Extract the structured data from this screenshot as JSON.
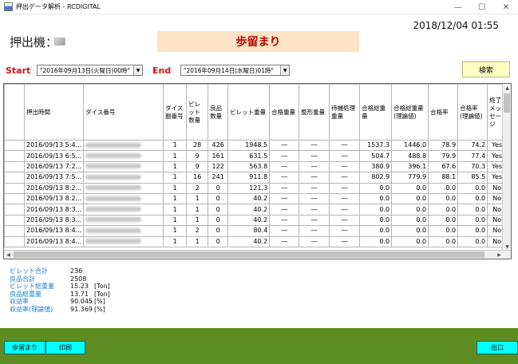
{
  "window": {
    "title": "押出データ解析 - RCDIGITAL"
  },
  "header": {
    "datetime": "2018/12/04  01:55",
    "machine_label": "押出機：",
    "banner": "歩留まり"
  },
  "filter": {
    "start_label": "Start",
    "start_value": "\"2016年09月13日(火曜日)00時\"",
    "end_label": "End",
    "end_value": "\"2016年09月14日(水曜日)01時\"",
    "search_label": "検索"
  },
  "grid": {
    "columns": [
      "押出時間",
      "ダイス番号",
      "ダイス副番号",
      "ビレット数量",
      "良品数量",
      "ビレット重量",
      "合格重量",
      "整形重量",
      "待機処理重量",
      "合格総重量",
      "合格総重量(理論値)",
      "合格率",
      "合格率(理論値)",
      "終了メッセージ"
    ],
    "rows": [
      [
        "2016/09/13 5:4...",
        "",
        "1",
        "28",
        "426",
        "1948.5",
        "―",
        "―",
        "―",
        "1537.3",
        "1446.0",
        "78.9",
        "74.2",
        "Yes"
      ],
      [
        "2016/09/13 6:5...",
        "",
        "1",
        "9",
        "161",
        "631.5",
        "―",
        "―",
        "―",
        "504.7",
        "488.8",
        "79.9",
        "77.4",
        "Yes"
      ],
      [
        "2016/09/13 7:2...",
        "",
        "1",
        "9",
        "122",
        "563.8",
        "―",
        "―",
        "―",
        "380.9",
        "396.1",
        "67.6",
        "70.3",
        "Yes"
      ],
      [
        "2016/09/13 7:5...",
        "",
        "1",
        "16",
        "241",
        "911.8",
        "―",
        "―",
        "―",
        "802.9",
        "779.9",
        "88.1",
        "85.5",
        "Yes"
      ],
      [
        "2016/09/13 8:2...",
        "",
        "1",
        "2",
        "0",
        "121.3",
        "―",
        "―",
        "―",
        "0.0",
        "0.0",
        "0.0",
        "0.0",
        "No"
      ],
      [
        "2016/09/13 8:2...",
        "",
        "1",
        "1",
        "0",
        "40.2",
        "―",
        "―",
        "―",
        "0.0",
        "0.0",
        "0.0",
        "0.0",
        "No"
      ],
      [
        "2016/09/13 8:3...",
        "",
        "1",
        "1",
        "0",
        "40.2",
        "―",
        "―",
        "―",
        "0.0",
        "0.0",
        "0.0",
        "0.0",
        "No"
      ],
      [
        "2016/09/13 8:3...",
        "",
        "1",
        "1",
        "0",
        "40.2",
        "―",
        "―",
        "―",
        "0.0",
        "0.0",
        "0.0",
        "0.0",
        "No"
      ],
      [
        "2016/09/13 8:4...",
        "",
        "1",
        "2",
        "0",
        "80.4",
        "―",
        "―",
        "―",
        "0.0",
        "0.0",
        "0.0",
        "0.0",
        "No"
      ],
      [
        "2016/09/13 8:4...",
        "",
        "1",
        "1",
        "0",
        "40.2",
        "―",
        "―",
        "―",
        "0.0",
        "0.0",
        "0.0",
        "0.0",
        "No"
      ]
    ]
  },
  "summary": [
    {
      "label": "ビレット合計",
      "value": "236",
      "unit": ""
    },
    {
      "label": "良品合計",
      "value": "2508",
      "unit": ""
    },
    {
      "label": "ビレット総重量",
      "value": "15.23",
      "unit": "[Ton]"
    },
    {
      "label": "良品総重量",
      "value": "13.71",
      "unit": "[Ton]"
    },
    {
      "label": "収益率",
      "value": "90.045",
      "unit": "[%]"
    },
    {
      "label": "収益率(理論値)",
      "value": "91.369",
      "unit": "[%]"
    }
  ],
  "footer": {
    "yield_button": "歩留まり",
    "print_button": "印刷",
    "exit_button": "出口"
  },
  "colors": {
    "banner_bg": "#fbe3c4",
    "banner_text": "#c00000",
    "label_red": "#d81414",
    "search_bg": "#ffffc4",
    "summary_label": "#1a7fd4",
    "footer_bar": "#5d8c22",
    "footer_button": "#00ffff"
  }
}
